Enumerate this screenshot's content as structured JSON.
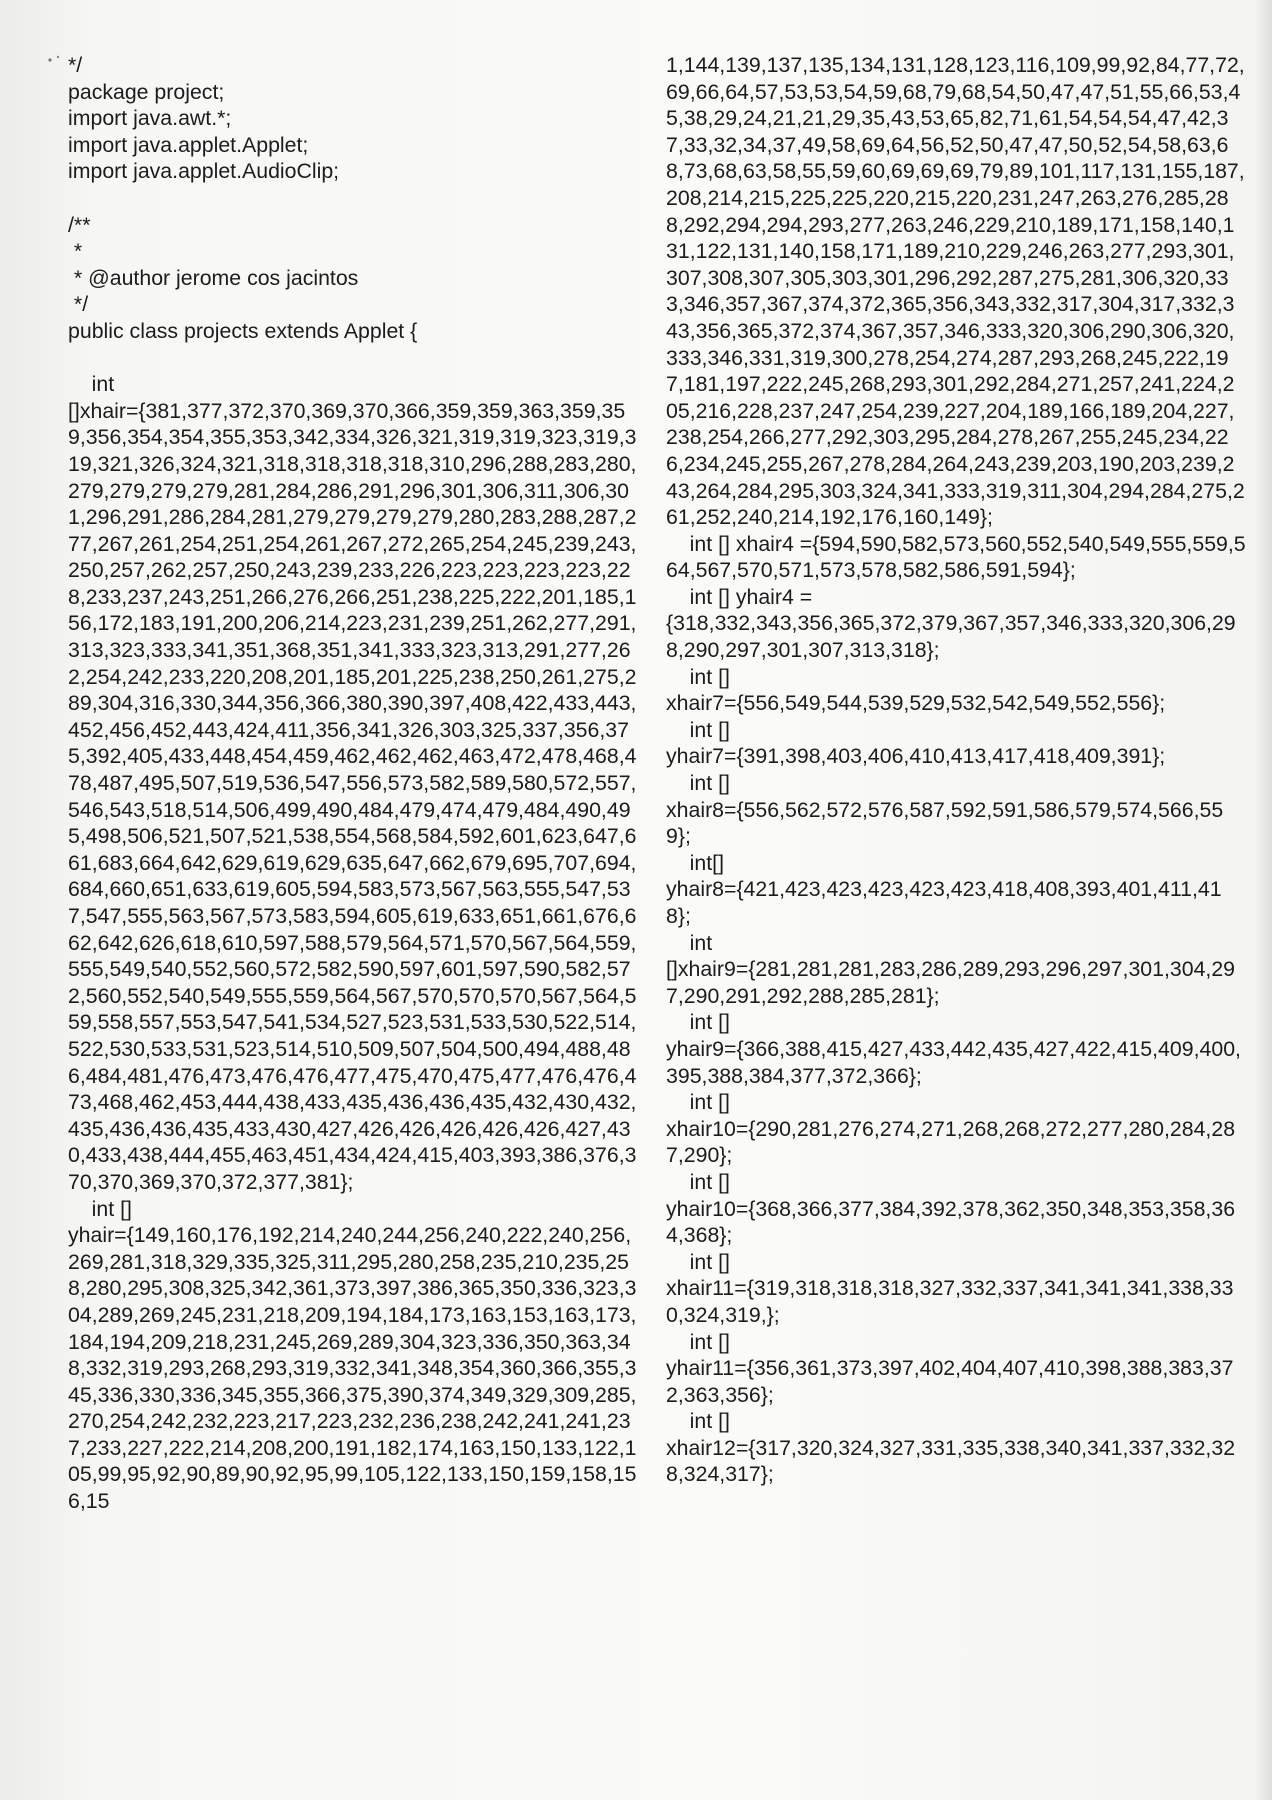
{
  "left_lines": [
    "*/",
    "package project;",
    "import java.awt.*;",
    "import java.applet.Applet;",
    "import java.applet.AudioClip;",
    "",
    "/**",
    " *",
    " * @author jerome cos jacintos",
    " */",
    "public class projects extends Applet {",
    "",
    "    int",
    "[]xhair={381,377,372,370,369,370,366,359,359,363,359,359,356,354,354,355,353,342,334,326,321,319,319,323,319,319,321,326,324,321,318,318,318,318,310,296,288,283,280,279,279,279,279,281,284,286,291,296,301,306,311,306,301,296,291,286,284,281,279,279,279,279,280,283,288,287,277,267,261,254,251,254,261,267,272,265,254,245,239,243,250,257,262,257,250,243,239,233,226,223,223,223,223,228,233,237,243,251,266,276,266,251,238,225,222,201,185,156,172,183,191,200,206,214,223,231,239,251,262,277,291,313,323,333,341,351,368,351,341,333,323,313,291,277,262,254,242,233,220,208,201,185,201,225,238,250,261,275,289,304,316,330,344,356,366,380,390,397,408,422,433,443,452,456,452,443,424,411,356,341,326,303,325,337,356,375,392,405,433,448,454,459,462,462,462,463,472,478,468,478,487,495,507,519,536,547,556,573,582,589,580,572,557,546,543,518,514,506,499,490,484,479,474,479,484,490,495,498,506,521,507,521,538,554,568,584,592,601,623,647,661,683,664,642,629,619,629,635,647,662,679,695,707,694,684,660,651,633,619,605,594,583,573,567,563,555,547,537,547,555,563,567,573,583,594,605,619,633,651,661,676,662,642,626,618,610,597,588,579,564,571,570,567,564,559,555,549,540,552,560,572,582,590,597,601,597,590,582,572,560,552,540,549,555,559,564,567,570,570,570,567,564,559,558,557,553,547,541,534,527,523,531,533,530,522,514,522,530,533,531,523,514,510,509,507,504,500,494,488,486,484,481,476,473,476,476,477,475,470,475,477,476,476,473,468,462,453,444,438,433,435,436,436,435,432,430,432,435,436,436,435,433,430,427,426,426,426,426,426,427,430,433,438,444,455,463,451,434,424,415,403,393,386,376,370,370,369,370,372,377,381};",
    "    int []",
    "yhair={149,160,176,192,214,240,244,256,240,222,240,256,269,281,318,329,335,325,311,295,280,258,235,210,235,258,280,295,308,325,342,361,373,397,386,365,350,336,323,304,289,269,245,231,218,209,194,184,173,163,153,163,173,184,194,209,218,231,245,269,289,304,323,336,350,363,348,332,319,293,268,293,319,332,341,348,354,360,366,355,345,336,330,336,345,355,366,375,390,374,349,329,309,285,270,254,242,232,223,217,223,232,236,238,242,241,241,237,233,227,222,214,208,200,191,182,174,163,150,133,122,105,99,95,92,90,89,90,92,95,99,105,122,133,150,159,158,156,15"
  ],
  "right_lines": [
    "1,144,139,137,135,134,131,128,123,116,109,99,92,84,77,72,69,66,64,57,53,53,54,59,68,79,68,54,50,47,47,51,55,66,53,45,38,29,24,21,21,29,35,43,53,65,82,71,61,54,54,54,47,42,37,33,32,34,37,49,58,69,64,56,52,50,47,47,50,52,54,58,63,68,73,68,63,58,55,59,60,69,69,69,79,89,101,117,131,155,187,208,214,215,225,225,220,215,220,231,247,263,276,285,288,292,294,294,293,277,263,246,229,210,189,171,158,140,131,122,131,140,158,171,189,210,229,246,263,277,293,301,307,308,307,305,303,301,296,292,287,275,281,306,320,333,346,357,367,374,372,365,356,343,332,317,304,317,332,343,356,365,372,374,367,357,346,333,320,306,290,306,320,333,346,331,319,300,278,254,274,287,293,268,245,222,197,181,197,222,245,268,293,301,292,284,271,257,241,224,205,216,228,237,247,254,239,227,204,189,166,189,204,227,238,254,266,277,292,303,295,284,278,267,255,245,234,226,234,245,255,267,278,284,264,243,239,203,190,203,239,243,264,284,295,303,324,341,333,319,311,304,294,284,275,261,252,240,214,192,176,160,149};",
    "    int [] xhair4 ={594,590,582,573,560,552,540,549,555,559,564,567,570,571,573,578,582,586,591,594};",
    "    int [] yhair4 =",
    "{318,332,343,356,365,372,379,367,357,346,333,320,306,298,290,297,301,307,313,318};",
    "    int []",
    "xhair7={556,549,544,539,529,532,542,549,552,556};",
    "    int []",
    "yhair7={391,398,403,406,410,413,417,418,409,391};",
    "    int []",
    "xhair8={556,562,572,576,587,592,591,586,579,574,566,559};",
    "    int[]",
    "yhair8={421,423,423,423,423,423,418,408,393,401,411,418};",
    "    int",
    "[]xhair9={281,281,281,283,286,289,293,296,297,301,304,297,290,291,292,288,285,281};",
    "    int []",
    "yhair9={366,388,415,427,433,442,435,427,422,415,409,400,395,388,384,377,372,366};",
    "    int []",
    "xhair10={290,281,276,274,271,268,268,272,277,280,284,287,290};",
    "    int []",
    "yhair10={368,366,377,384,392,378,362,350,348,353,358,364,368};",
    "    int []",
    "xhair11={319,318,318,318,327,332,337,341,341,341,338,330,324,319,};",
    "    int []",
    "yhair11={356,361,373,397,402,404,407,410,398,388,383,372,363,356};",
    "    int []",
    "xhair12={317,320,324,327,331,335,338,340,341,337,332,328,324,317};"
  ]
}
